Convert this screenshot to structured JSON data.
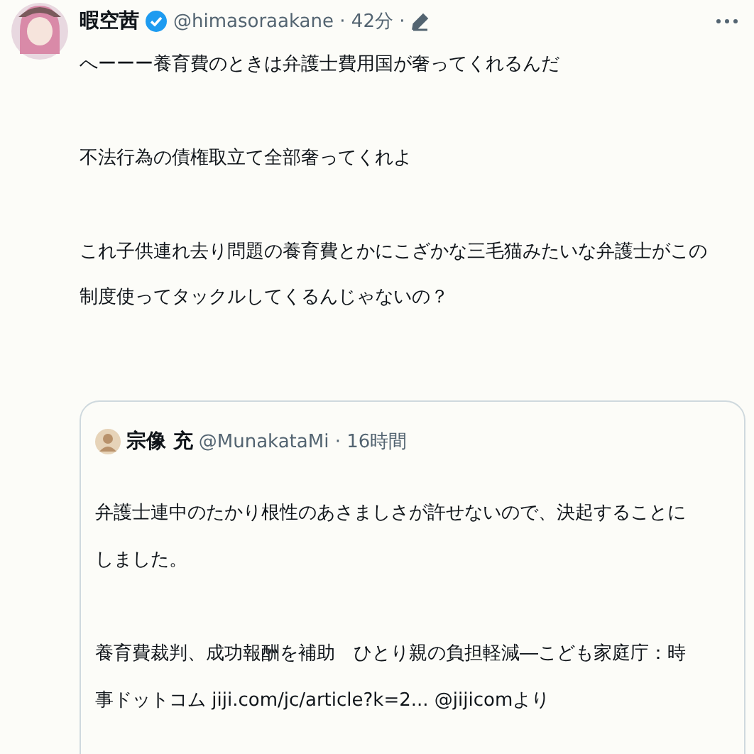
{
  "post": {
    "author": "暇空茜",
    "verified": true,
    "handle": "@himasoraakane",
    "separator": "·",
    "time": "42分",
    "paragraphs": [
      {
        "lines": [
          "へーーー養育費のときは弁護士費用国が奢ってくれるんだ"
        ]
      },
      {
        "lines": [
          "不法行為の債権取立て全部奢ってくれよ"
        ]
      },
      {
        "lines": [
          "これ子供連れ去り問題の養育費とかにこざかな三毛猫みたいな弁護士がこの",
          "制度使ってタックルしてくるんじゃないの？"
        ]
      }
    ]
  },
  "quote": {
    "author": "宗像 充",
    "handle": "@MunakataMi",
    "separator": "·",
    "time": "16時間",
    "paragraphs": [
      {
        "lines": [
          "弁護士連中のたかり根性のあさましさが許せないので、決起することに",
          "しました。"
        ]
      },
      {
        "lines": [
          "養育費裁判、成功報酬を補助　ひとり親の負担軽減―こども家庭庁：時",
          "事ドットコム jiji.com/jc/article?k=2... @jijicomより"
        ]
      }
    ]
  }
}
